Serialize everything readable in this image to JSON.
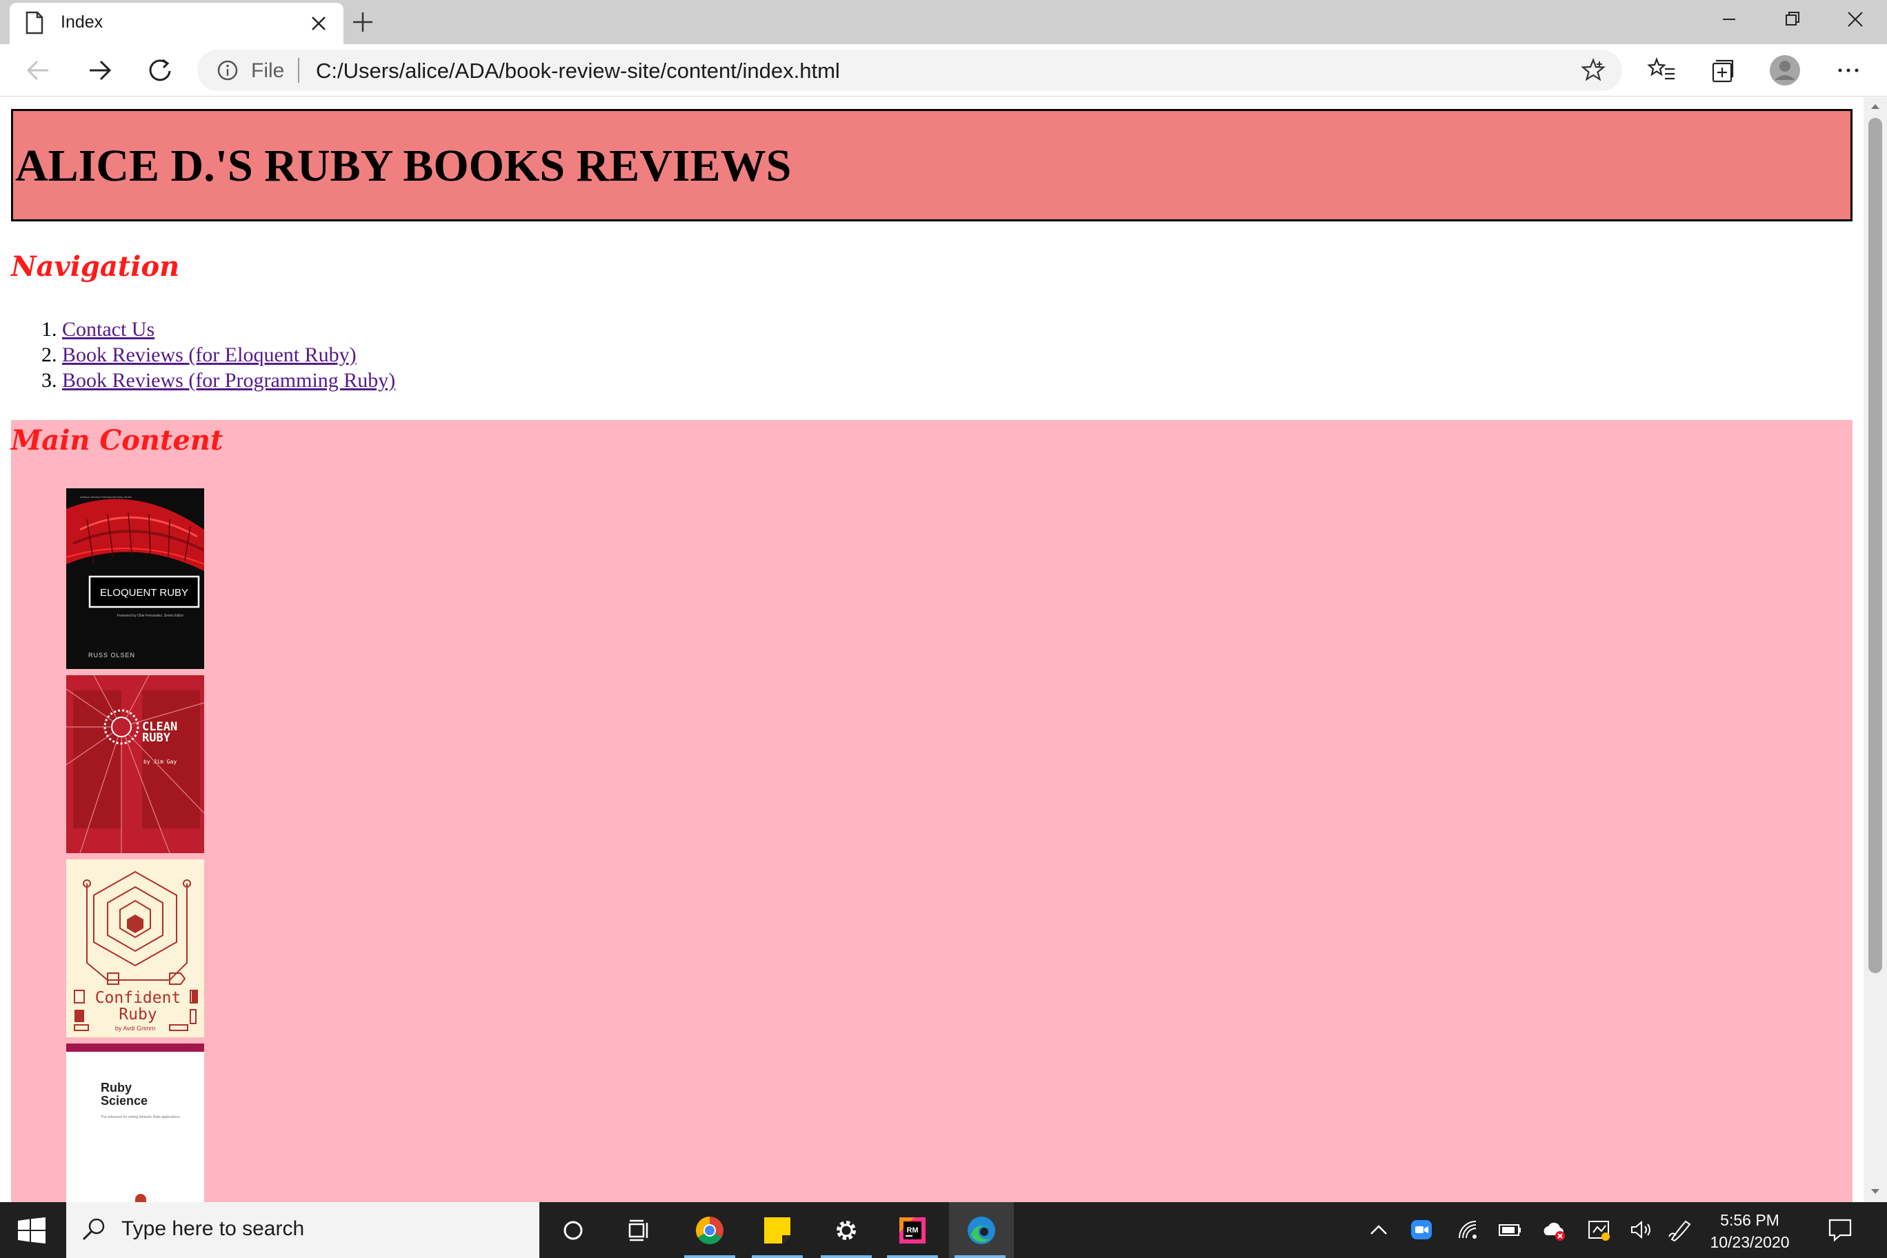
{
  "browser": {
    "tab_title": "Index",
    "address_scheme_label": "File",
    "address_url": "C:/Users/alice/ADA/book-review-site/content/index.html"
  },
  "page": {
    "header_title": "ALICE D.'S RUBY BOOKS REVIEWS",
    "navigation_heading": "Navigation",
    "nav_links": [
      {
        "number": "1.",
        "label": "Contact Us"
      },
      {
        "number": "2.",
        "label": "Book Reviews (for Eloquent Ruby)"
      },
      {
        "number": "3.",
        "label": "Book Reviews (for Programming Ruby)"
      }
    ],
    "main_heading": "Main Content",
    "books": [
      {
        "cover_text": "ELOQUENT RUBY",
        "publisher_line": "Addison-Wesley Professional Ruby Series",
        "foreword": "Foreword by Obie Fernandez, Series Editor",
        "author": "RUSS OLSEN"
      },
      {
        "cover_text_1": "CLEAN",
        "cover_text_2": "RUBY",
        "author": "by Jim Gay"
      },
      {
        "cover_text_1": "Confident",
        "cover_text_2": "Ruby",
        "author": "by Avdi Grimm"
      },
      {
        "cover_text_1": "Ruby",
        "cover_text_2": "Science",
        "subtitle": "The reference for writing fantastic Rails applications."
      }
    ],
    "header_color": "#f08080",
    "main_bg_color": "#ffb6c1",
    "heading_color": "#ff1a1a"
  },
  "taskbar": {
    "search_placeholder": "Type here to search",
    "time": "5:56 PM",
    "date": "10/23/2020",
    "rubymine_label": "RM"
  }
}
